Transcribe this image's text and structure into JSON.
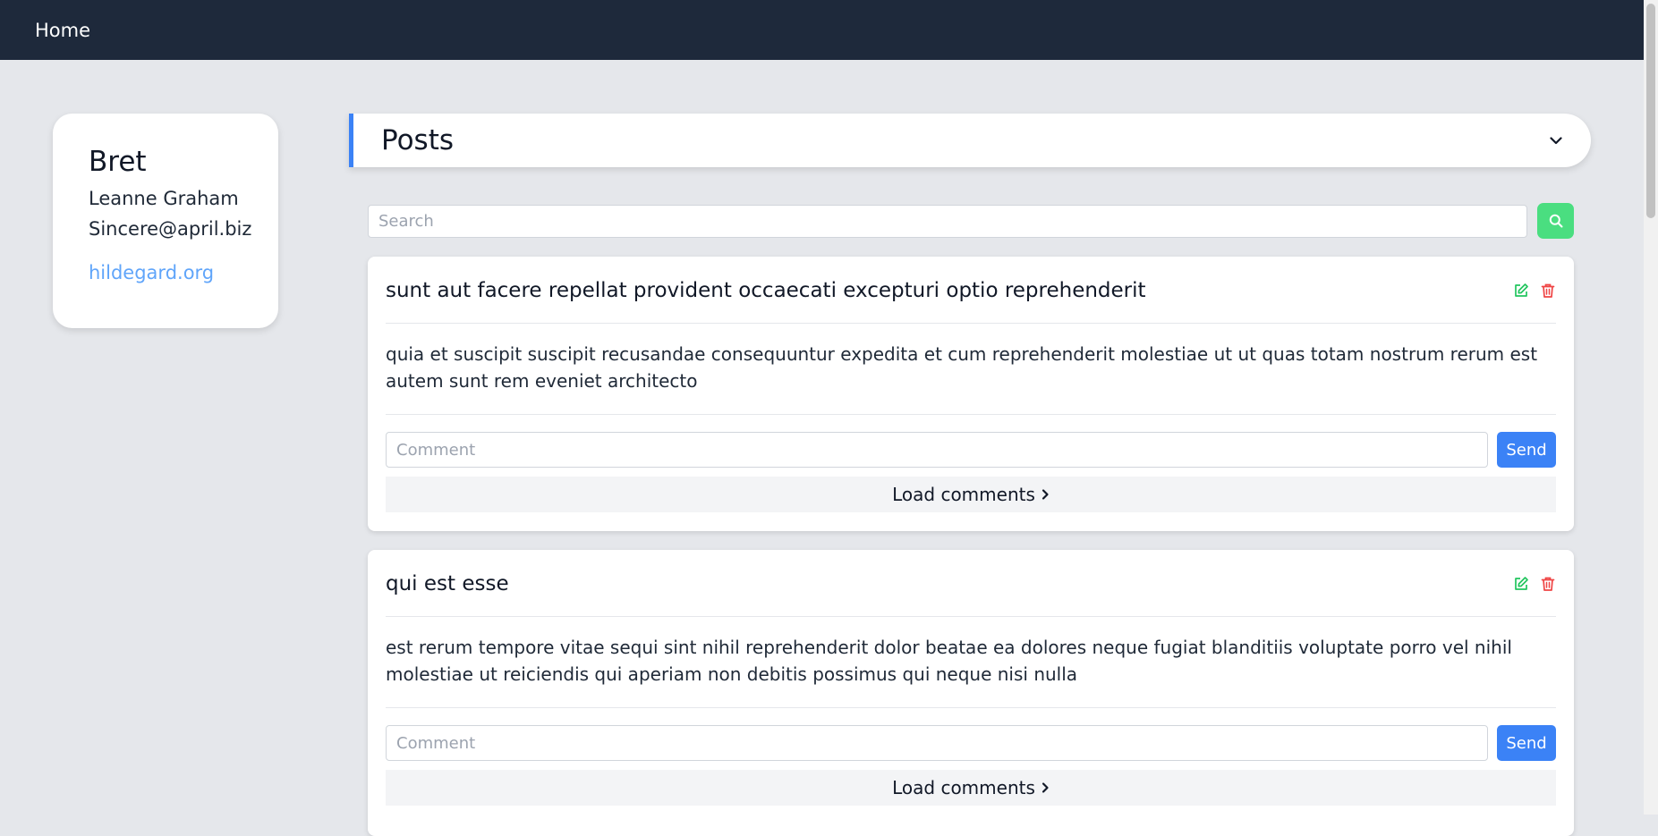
{
  "nav": {
    "home_label": "Home"
  },
  "profile": {
    "username": "Bret",
    "name": "Leanne Graham",
    "email": "Sincere@april.biz",
    "website": "hildegard.org"
  },
  "posts_panel": {
    "title": "Posts",
    "search_placeholder": "Search",
    "search_icon": "search-icon"
  },
  "posts": [
    {
      "title": "sunt aut facere repellat provident occaecati excepturi optio reprehenderit",
      "body": "quia et suscipit suscipit recusandae consequuntur expedita et cum reprehenderit molestiae ut ut quas totam nostrum rerum est autem sunt rem eveniet architecto",
      "comment_placeholder": "Comment",
      "send_label": "Send",
      "load_label": "Load comments"
    },
    {
      "title": "qui est esse",
      "body": "est rerum tempore vitae sequi sint nihil reprehenderit dolor beatae ea dolores neque fugiat blanditiis voluptate porro vel nihil molestiae ut reiciendis qui aperiam non debitis possimus qui neque nisi nulla",
      "comment_placeholder": "Comment",
      "send_label": "Send",
      "load_label": "Load comments"
    }
  ],
  "colors": {
    "topbar": "#1e293b",
    "accent": "#3b82f6",
    "link": "#60a5fa",
    "search_button": "#4ade80",
    "edit_icon": "#22c55e",
    "delete_icon": "#ef4444"
  }
}
